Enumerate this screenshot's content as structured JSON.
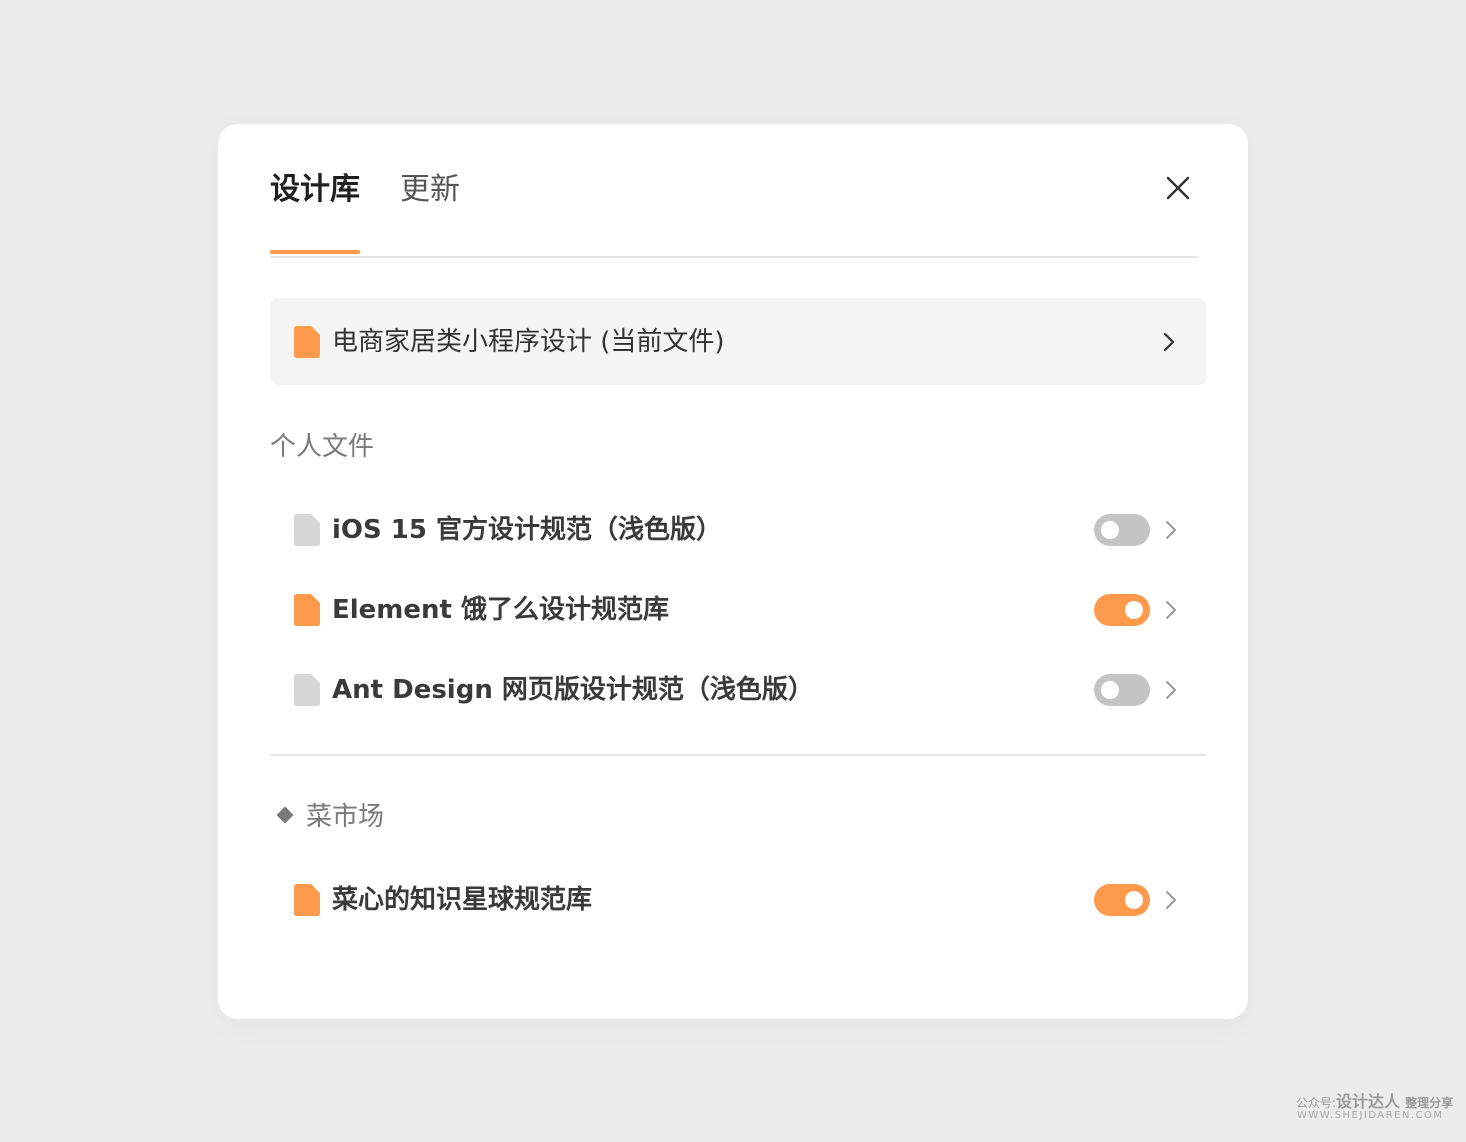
{
  "tabs": [
    {
      "label": "设计库",
      "active": true
    },
    {
      "label": "更新",
      "active": false
    }
  ],
  "current_file": {
    "label": "电商家居类小程序设计 (当前文件)",
    "icon": "file-icon",
    "icon_color": "#ff9a4d"
  },
  "personal_section": {
    "title": "个人文件",
    "items": [
      {
        "label": "iOS 15 官方设计规范（浅色版）",
        "enabled": false,
        "icon_color": "#d6d6d6"
      },
      {
        "label": "Element 饿了么设计规范库",
        "enabled": true,
        "icon_color": "#ff9a4d"
      },
      {
        "label": "Ant Design 网页版设计规范（浅色版）",
        "enabled": false,
        "icon_color": "#d6d6d6"
      }
    ]
  },
  "market_section": {
    "title": "菜市场",
    "icon": "diamond-icon",
    "items": [
      {
        "label": "菜心的知识星球规范库",
        "enabled": true,
        "icon_color": "#ff9a4d"
      }
    ]
  },
  "watermark": {
    "prefix": "公众号:",
    "brand": "设计达人",
    "suffix": "整理分享",
    "url": "WWW.SHEJIDAREN.COM"
  },
  "colors": {
    "accent": "#ff9a4d",
    "toggle_off": "#c4c4c4",
    "background": "#ebecee",
    "panel": "#ffffff"
  }
}
